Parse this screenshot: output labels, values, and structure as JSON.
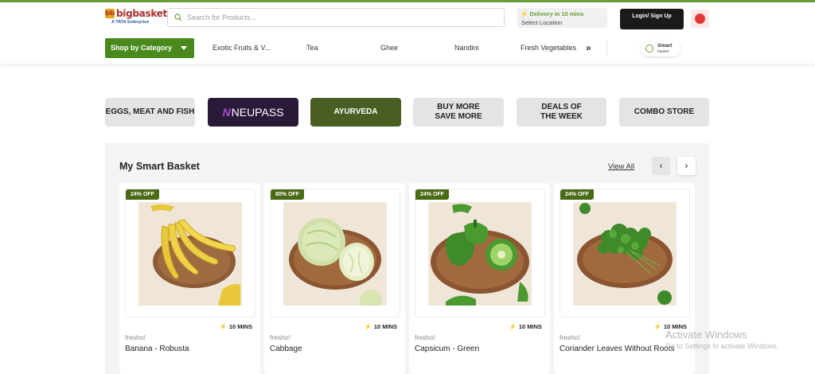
{
  "header": {
    "logo_text": "bigbasket",
    "logo_sub": "A TATA Enterprise",
    "search_placeholder": "Search for Products...",
    "delivery_title": "Delivery in 10 mins",
    "delivery_sub": "Select Location",
    "login_label": "Login/ Sign Up"
  },
  "nav": {
    "shop_by_category": "Shop by Category",
    "items": [
      "Exotic Fruits & V...",
      "Tea",
      "Ghee",
      "Nandini",
      "Fresh Vegetables"
    ],
    "more_arrow": "»",
    "smart_label": "Smart",
    "smart_sub": "basket"
  },
  "banners": [
    "EGGS, MEAT AND FISH",
    "NEUPASS",
    "AYURVEDA",
    "BUY MORE SAVE MORE",
    "DEALS OF THE WEEK",
    "COMBO STORE"
  ],
  "smart_basket": {
    "title": "My Smart Basket",
    "view_all": "View All",
    "prev": "‹",
    "next": "›",
    "products": [
      {
        "discount": "24% OFF",
        "delivery": "10 MINS",
        "brand": "fresho!",
        "name": "Banana - Robusta"
      },
      {
        "discount": "80% OFF",
        "delivery": "10 MINS",
        "brand": "fresho!",
        "name": "Cabbage"
      },
      {
        "discount": "24% OFF",
        "delivery": "10 MINS",
        "brand": "fresho!",
        "name": "Capsicum - Green"
      },
      {
        "discount": "24% OFF",
        "delivery": "10 MINS",
        "brand": "fresho!",
        "name": "Coriander Leaves Without Roots"
      }
    ]
  },
  "watermark": {
    "line1": "Activate Windows",
    "line2": "Go to Settings to activate Windows."
  },
  "colors": {
    "brand_green": "#4a8a1c",
    "badge_green": "#4a6b15",
    "brand_red": "#a8302d"
  }
}
